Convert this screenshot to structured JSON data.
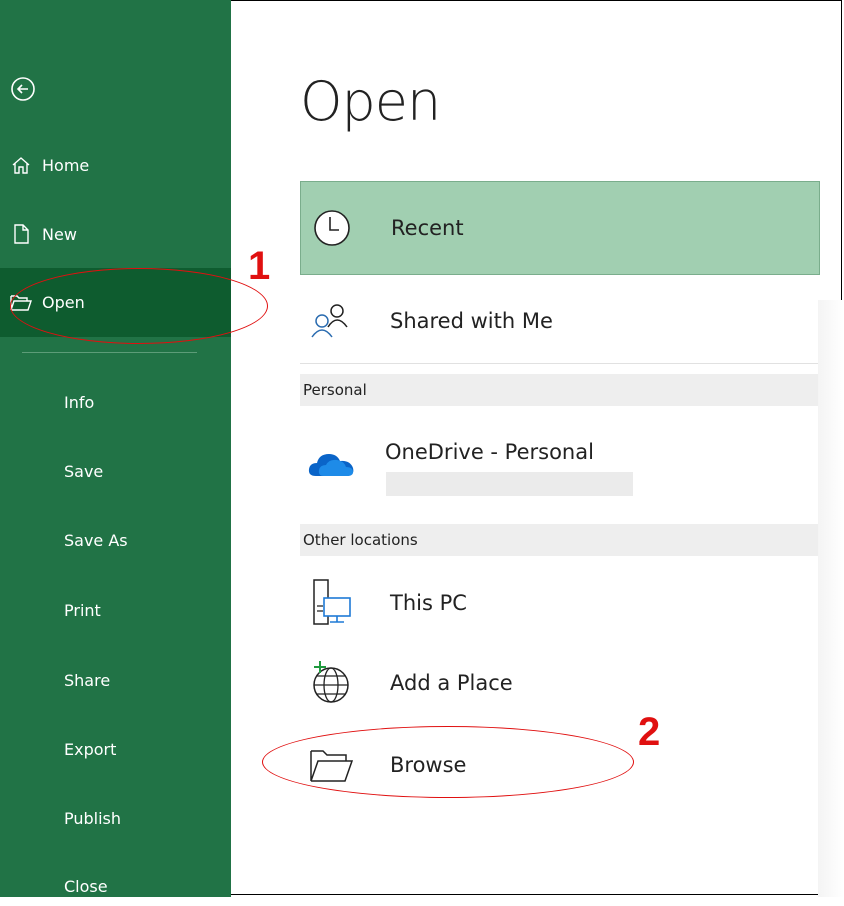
{
  "sidebar": {
    "back_label": "Back",
    "items": [
      {
        "label": "Home",
        "icon": "home-icon"
      },
      {
        "label": "New",
        "icon": "new-document-icon"
      },
      {
        "label": "Open",
        "icon": "folder-open-icon",
        "selected": true
      },
      {
        "label": "Info"
      },
      {
        "label": "Save"
      },
      {
        "label": "Save As"
      },
      {
        "label": "Print"
      },
      {
        "label": "Share"
      },
      {
        "label": "Export"
      },
      {
        "label": "Publish"
      },
      {
        "label": "Close"
      }
    ]
  },
  "main": {
    "title": "Open",
    "recent": {
      "label": "Recent",
      "icon": "clock-icon"
    },
    "shared": {
      "label": "Shared with Me",
      "icon": "people-icon"
    },
    "personal_header": "Personal",
    "onedrive": {
      "label": "OneDrive - Personal",
      "icon": "cloud-icon"
    },
    "other_header": "Other locations",
    "this_pc": {
      "label": "This PC",
      "icon": "computer-icon"
    },
    "add_place": {
      "label": "Add a Place",
      "icon": "globe-add-icon"
    },
    "browse": {
      "label": "Browse",
      "icon": "folder-icon"
    }
  },
  "annotations": {
    "step1": "1",
    "step2": "2",
    "color": "#e01010"
  },
  "colors": {
    "sidebar": "#217346",
    "sidebar_selected": "#0e5c2f",
    "recent_highlight": "#a1cfb1"
  }
}
